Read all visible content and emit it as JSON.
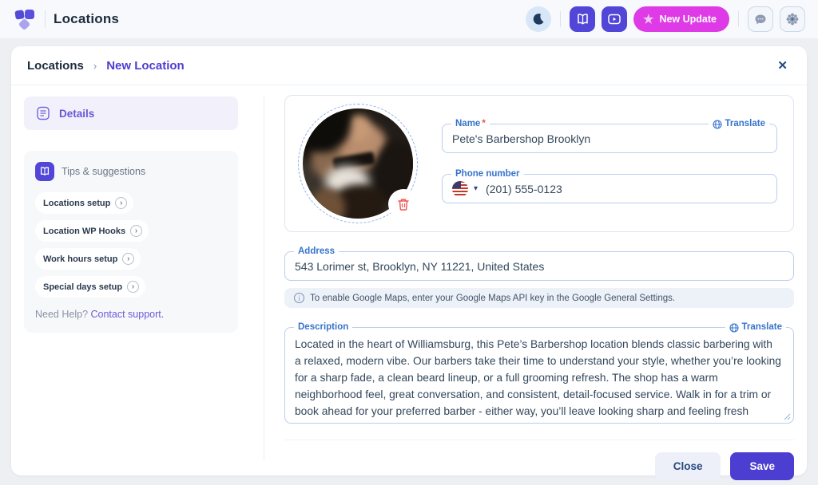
{
  "header": {
    "app_title": "Locations",
    "new_update_label": "New Update",
    "star_glyph": "★"
  },
  "breadcrumb": {
    "parent": "Locations",
    "separator": "›",
    "current": "New Location",
    "close_glyph": "✕"
  },
  "sidebar": {
    "details_label": "Details",
    "tips_title": "Tips & suggestions",
    "chips": [
      "Locations setup",
      "Location WP Hooks",
      "Work hours setup",
      "Special days setup"
    ],
    "chip_chevron": "›",
    "help_text": "Need Help?",
    "help_link": "Contact support."
  },
  "form": {
    "name": {
      "label": "Name",
      "required_mark": "*",
      "translate_label": "Translate",
      "value": "Pete's Barbershop Brooklyn"
    },
    "phone": {
      "label": "Phone number",
      "value": "(201) 555-0123",
      "chevron": "▾"
    },
    "address": {
      "label": "Address",
      "value": "543 Lorimer st, Brooklyn, NY 11221, United States"
    },
    "maps_note": "To enable Google Maps, enter your Google Maps API key in the Google General Settings.",
    "maps_note_icon": "i",
    "description": {
      "label": "Description",
      "translate_label": "Translate",
      "value": "Located in the heart of Williamsburg, this Pete’s Barbershop location blends classic barbering with a relaxed, modern vibe. Our barbers take their time to understand your style, whether you’re looking for a sharp fade, a clean beard lineup, or a full grooming refresh. The shop has a warm neighborhood feel, great conversation, and consistent, detail-focused service. Walk in for a trim or book ahead for your preferred barber - either way, you’ll leave looking sharp and feeling fresh"
    }
  },
  "actions": {
    "close": "Close",
    "save": "Save"
  },
  "colors": {
    "accent_indigo": "#4c3ed0",
    "accent_magenta": "#de3be6",
    "field_label_blue": "#3673cc",
    "field_border": "#b9cfec",
    "danger_red": "#ef5350",
    "page_bg": "#edeff3"
  }
}
